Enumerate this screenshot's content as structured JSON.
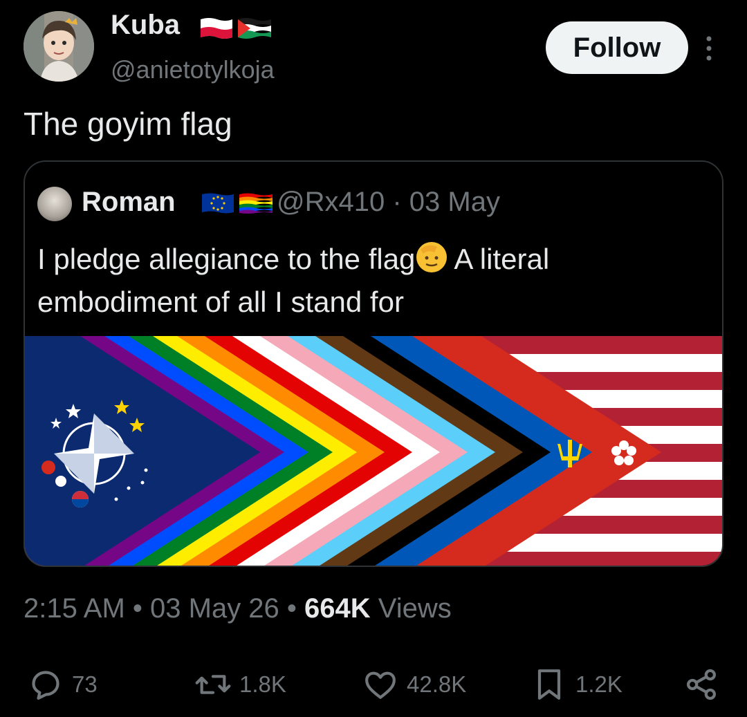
{
  "author": {
    "display_name": "Kuba",
    "handle": "@anietotylkoja",
    "flags": [
      "flag-poland",
      "flag-palestine"
    ]
  },
  "follow_label": "Follow",
  "tweet_text": "The goyim flag",
  "quote": {
    "display_name": "Roman",
    "flags": [
      "flag-eu",
      "flag-rainbow"
    ],
    "handle": "@Rx410",
    "date": "03 May",
    "text_part1": "I pledge allegiance to the flag",
    "text_part2": "A literal embodiment of all I stand for",
    "emoji": "saluting-face-emoji",
    "media": "collage flag image"
  },
  "meta": {
    "time": "2:15 AM",
    "date": "03 May 26",
    "views_count": "664K",
    "views_label": "Views"
  },
  "actions": {
    "replies": "73",
    "reposts": "1.8K",
    "likes": "42.8K",
    "bookmarks": "1.2K"
  },
  "colors": {
    "background": "#000000",
    "text_primary": "#e7e9ea",
    "text_secondary": "#71767b",
    "border": "#2f3336",
    "follow_bg": "#eff3f4"
  },
  "icons": [
    "more-vertical-icon",
    "reply-icon",
    "repost-icon",
    "like-icon",
    "bookmark-icon",
    "share-icon"
  ]
}
